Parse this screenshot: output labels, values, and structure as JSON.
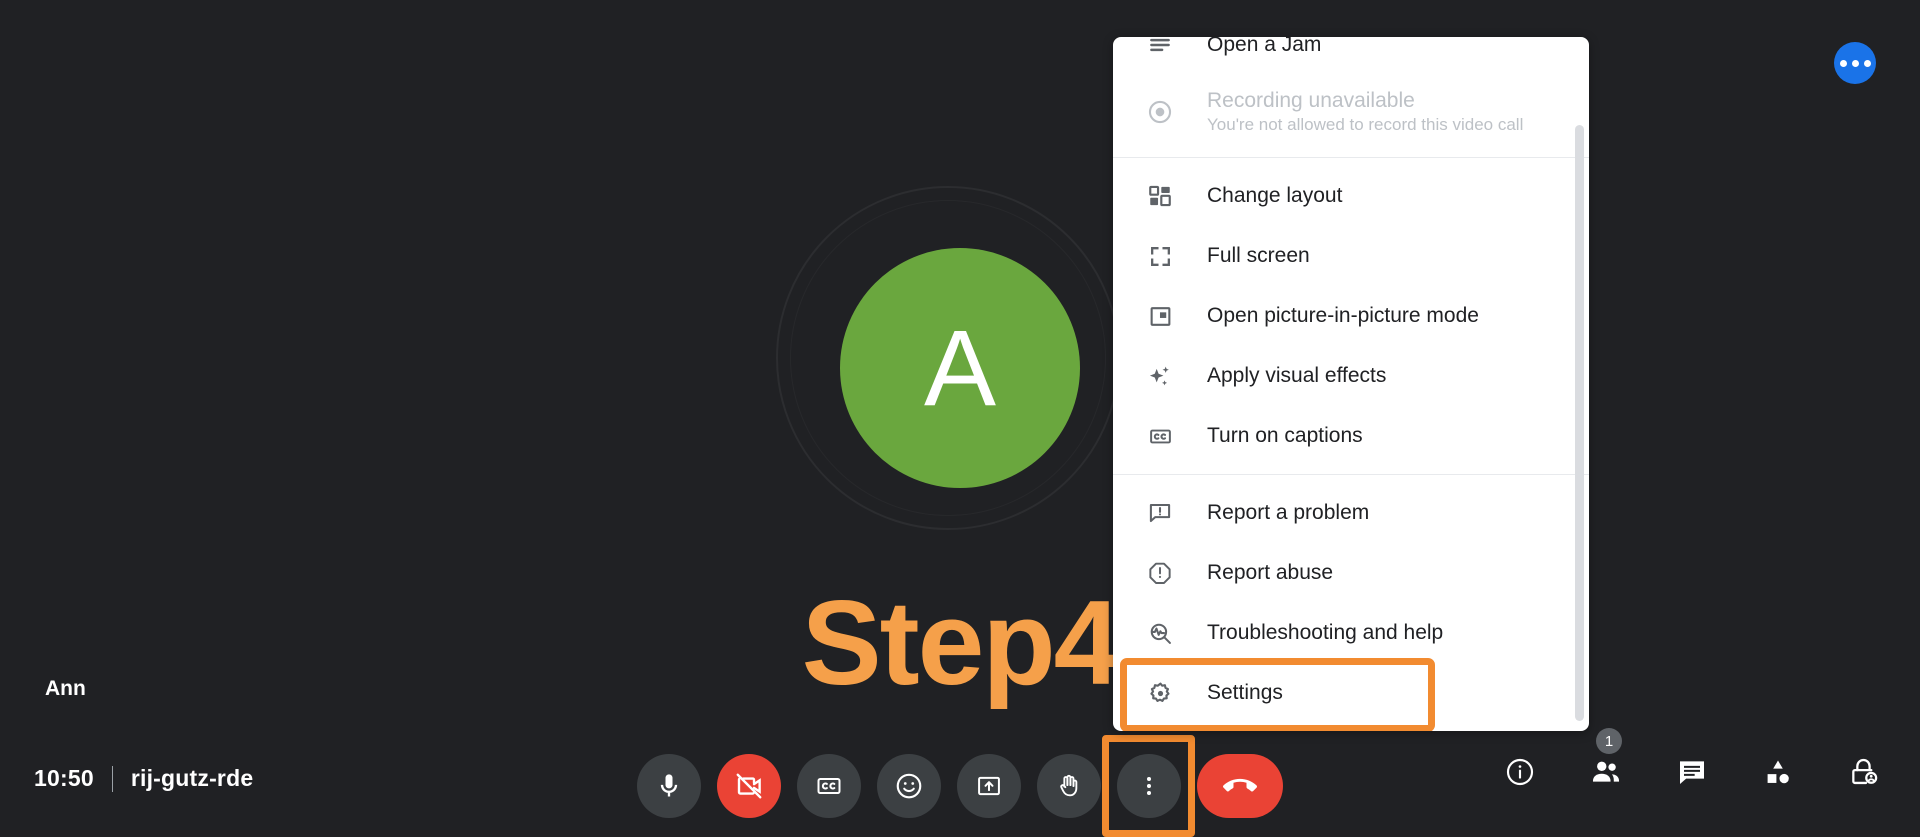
{
  "call": {
    "participant_name": "Ann",
    "avatar_letter": "A",
    "avatar_color": "#6aa73e",
    "overlay_label": "Step4",
    "overlay_color": "#f5a04a",
    "time": "10:50",
    "meeting_code": "rij-gutz-rde"
  },
  "menu": {
    "items": [
      {
        "id": "open-a-jam",
        "label": "Open a Jam",
        "icon": "jam-icon",
        "disabled": false
      },
      {
        "id": "recording-unavailable",
        "label": "Recording unavailable",
        "sublabel": "You're not allowed to record this video call",
        "icon": "record-icon",
        "disabled": true
      },
      {
        "id": "change-layout",
        "label": "Change layout",
        "icon": "layout-icon",
        "disabled": false
      },
      {
        "id": "full-screen",
        "label": "Full screen",
        "icon": "fullscreen-icon",
        "disabled": false
      },
      {
        "id": "open-pip",
        "label": "Open picture-in-picture mode",
        "icon": "picture-in-picture-icon",
        "disabled": false
      },
      {
        "id": "apply-visual-effects",
        "label": "Apply visual effects",
        "icon": "sparkle-icon",
        "disabled": false
      },
      {
        "id": "turn-on-captions",
        "label": "Turn on captions",
        "icon": "closed-caption-icon",
        "disabled": false
      },
      {
        "id": "report-a-problem",
        "label": "Report a problem",
        "icon": "feedback-icon",
        "disabled": false
      },
      {
        "id": "report-abuse",
        "label": "Report abuse",
        "icon": "report-icon",
        "disabled": false
      },
      {
        "id": "troubleshooting-and-help",
        "label": "Troubleshooting and help",
        "icon": "troubleshoot-icon",
        "disabled": false
      },
      {
        "id": "settings",
        "label": "Settings",
        "icon": "gear-icon",
        "disabled": false
      }
    ],
    "highlight_color": "#f28b30",
    "highlighted_item": "Settings"
  },
  "toolbar": {
    "microphone_label": "Turn off microphone",
    "camera_label": "Turn on camera",
    "captions_label": "Turn on captions",
    "reactions_label": "Send a reaction",
    "present_label": "Present now",
    "raise_hand_label": "Raise hand",
    "more_options_label": "More options",
    "leave_call_label": "Leave call"
  },
  "right_panel": {
    "meeting_details_label": "Meeting details",
    "people_label": "Show everyone",
    "people_count": "1",
    "chat_label": "Chat with everyone",
    "activities_label": "Activities",
    "host_controls_label": "Host controls"
  },
  "fab": {
    "label": "More",
    "color": "#1a73e8"
  }
}
